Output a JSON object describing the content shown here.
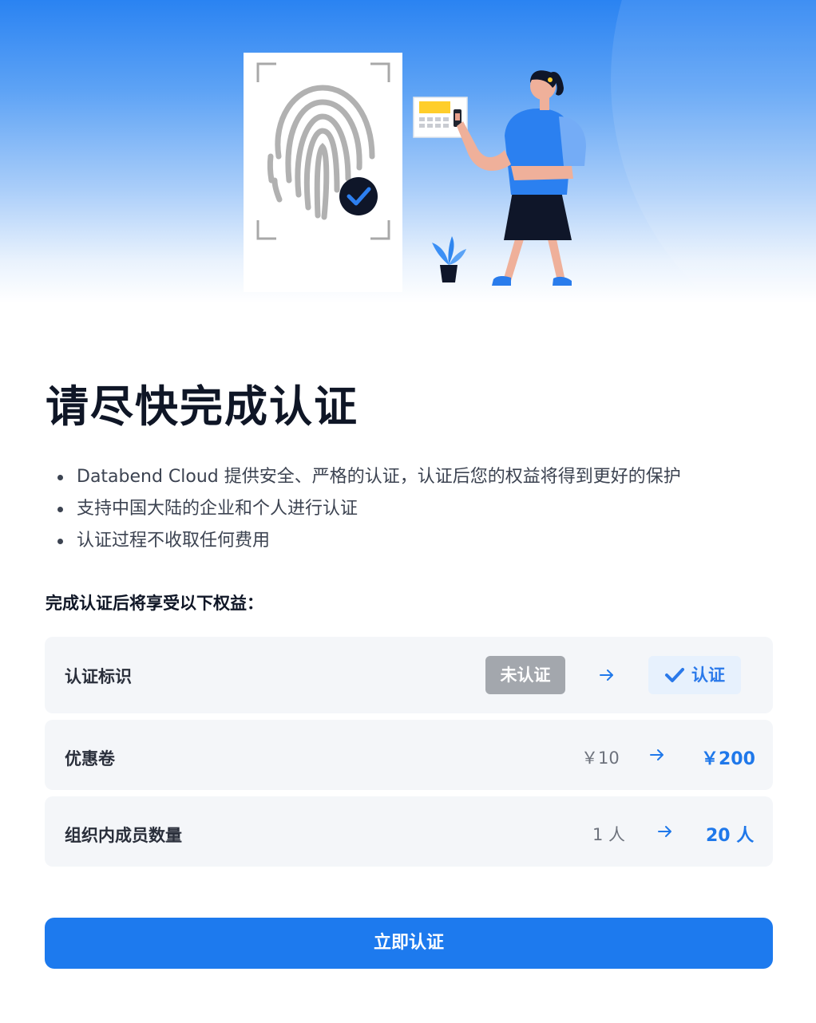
{
  "page": {
    "title": "请尽快完成认证",
    "bullets": [
      "Databend Cloud 提供安全、严格的认证，认证后您的权益将得到更好的保护",
      "支持中国大陆的企业和个人进行认证",
      "认证过程不收取任何费用"
    ],
    "benefits_heading": "完成认证后将享受以下权益："
  },
  "benefits": [
    {
      "label": "认证标识",
      "before": "未认证",
      "after": "认证"
    },
    {
      "label": "优惠卷",
      "before": "￥10",
      "after": "￥200"
    },
    {
      "label": "组织内成员数量",
      "before": "1 人",
      "after": "20 人"
    }
  ],
  "actions": {
    "verify_button": "立即认证"
  },
  "colors": {
    "primary": "#1d7aee",
    "hero_top": "#2a83f2",
    "row_bg": "#f4f6f9",
    "unverified_badge": "#a3a7ad"
  },
  "icons": [
    "fingerprint-icon",
    "check-circle-icon",
    "keypad-icon",
    "plant-icon",
    "arrow-right-icon",
    "checkmark-icon"
  ]
}
